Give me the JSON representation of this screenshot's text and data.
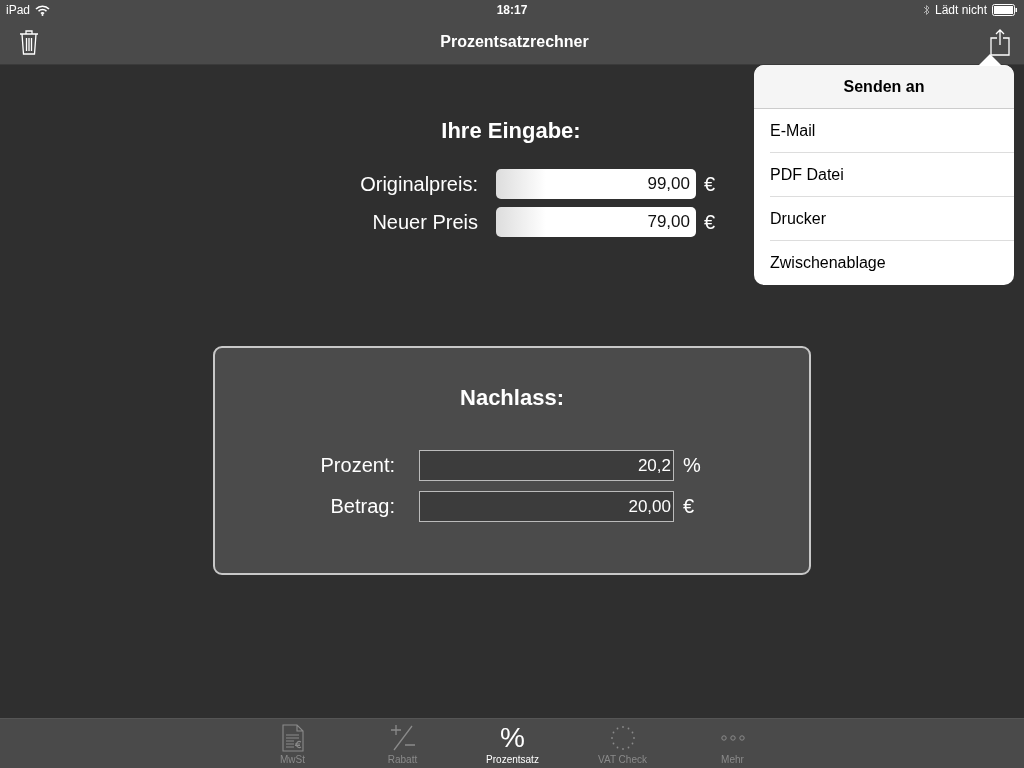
{
  "status_bar": {
    "device": "iPad",
    "time": "18:17",
    "charging": "Lädt nicht"
  },
  "nav_bar": {
    "title": "Prozentsatzrechner"
  },
  "input": {
    "heading": "Ihre Eingabe:",
    "fields": [
      {
        "label": "Originalpreis:",
        "value": "99,00",
        "unit": "€"
      },
      {
        "label": "Neuer Preis",
        "value": "79,00",
        "unit": "€"
      }
    ]
  },
  "result": {
    "heading": "Nachlass:",
    "fields": [
      {
        "label": "Prozent:",
        "value": "20,2",
        "unit": "%"
      },
      {
        "label": "Betrag:",
        "value": "20,00",
        "unit": "€"
      }
    ]
  },
  "popover": {
    "title": "Senden an",
    "items": [
      "E-Mail",
      "PDF Datei",
      "Drucker",
      "Zwischenablage"
    ]
  },
  "tab_bar": [
    {
      "kind": "document",
      "label": "MwSt",
      "selected": false
    },
    {
      "kind": "plusminus",
      "label": "Rabatt",
      "selected": false
    },
    {
      "kind": "percent",
      "label": "Prozentsatz",
      "selected": true,
      "glyph": "%"
    },
    {
      "kind": "stars",
      "label": "VAT Check",
      "selected": false
    },
    {
      "kind": "dots",
      "label": "Mehr",
      "selected": false
    }
  ]
}
